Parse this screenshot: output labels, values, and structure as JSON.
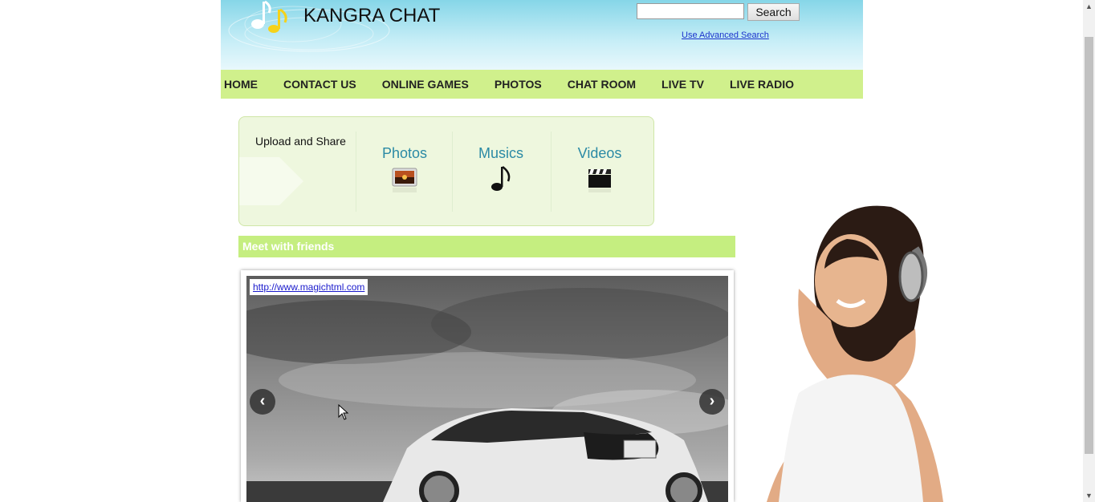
{
  "header": {
    "site_title": "KANGRA CHAT",
    "search_button": "Search",
    "search_value": "",
    "advanced_search_link": "Use Advanced Search"
  },
  "nav": {
    "items": [
      "HOME",
      "CONTACT US",
      "ONLINE GAMES",
      "PHOTOS",
      "CHAT ROOM",
      "LIVE TV",
      "LIVE RADIO"
    ]
  },
  "upload": {
    "title": "Upload and Share",
    "photos_label": "Photos",
    "musics_label": "Musics",
    "videos_label": "Videos"
  },
  "meet": {
    "title": "Meet with friends"
  },
  "slider": {
    "link_text": "http://www.magichtml.com",
    "prev_icon": "chevron-left-icon",
    "next_icon": "chevron-right-icon"
  },
  "colors": {
    "nav_bg": "#d0f08c",
    "meet_bar_bg": "#c5ee80",
    "media_label": "#2b8aa5",
    "header_top": "#86d6e8"
  }
}
